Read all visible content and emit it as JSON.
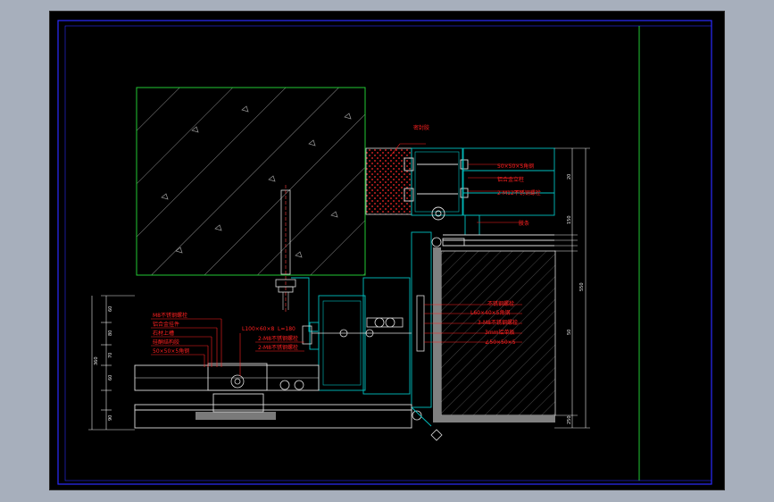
{
  "drawing": {
    "colors": {
      "background": "#000000",
      "frame": "#2b2bff",
      "divider": "#22c933",
      "concrete": "#7a7a7a",
      "stone": "#808080",
      "annotation": "#ff2020",
      "steel": "#00c0c0",
      "dimension": "#e8e8e8"
    },
    "callouts": {
      "top_block": "密封胶",
      "right_1": "50×50×5角钢",
      "right_2": "铝合金立柱",
      "right_3": "2-M12不锈钢螺栓",
      "right_4": "胶条",
      "right_5": "不锈钢螺栓",
      "right_6": "L60×40×5角钢",
      "right_7": "3-M8不锈钢螺栓",
      "right_8": "3mm铝单板",
      "right_9": "∠50×50×5",
      "left_1": "M8不锈钢螺栓",
      "left_2": "铝合金挂件",
      "left_3": "石材上槽",
      "left_4": "硅酮结构胶",
      "left_5": "50×50×5角钢",
      "mid_1": "L100×60×8",
      "mid_2": "L=180",
      "mid_3": "2-M8不锈钢螺栓",
      "mid_4": "2-M8不锈钢螺栓"
    },
    "dimensions": {
      "left_total": "360",
      "left_1": "60",
      "left_2": "80",
      "left_3": "70",
      "left_4": "60",
      "left_5": "90",
      "right_total": "550",
      "right_2": "20",
      "right_3": "150",
      "right_4": "50",
      "right_5": "250"
    }
  }
}
